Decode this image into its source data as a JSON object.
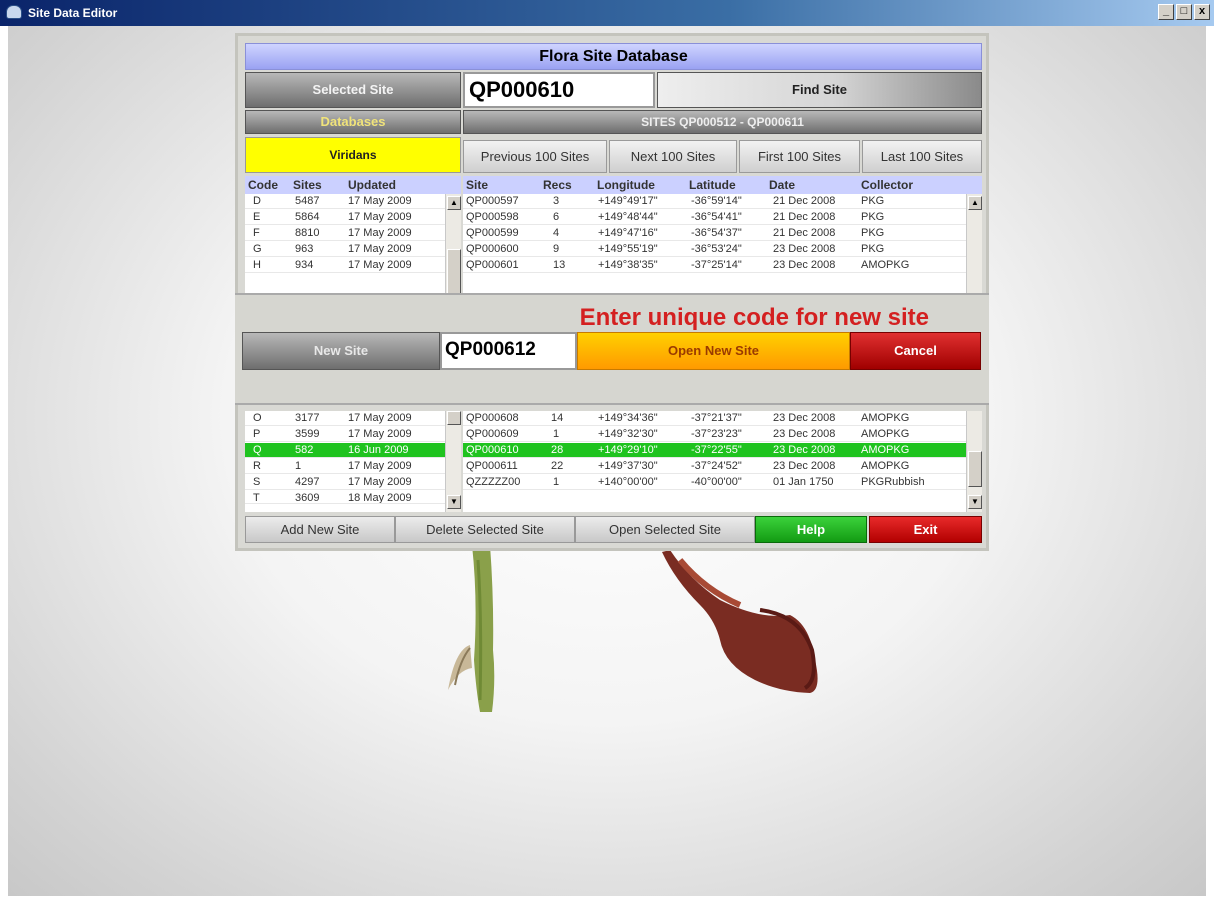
{
  "window": {
    "title": "Site Data Editor",
    "controls": [
      "_",
      "□",
      "x"
    ]
  },
  "dialog": {
    "header": "Flora Site Database",
    "selected_site_label": "Selected Site",
    "selected_site_value": "QP000610",
    "find_site_label": "Find Site",
    "databases_label": "Databases",
    "sites_range": "SITES QP000512 - QP000611",
    "database_name": "Viridans",
    "nav": {
      "previous": "Previous 100 Sites",
      "next": "Next 100 Sites",
      "first": "First 100 Sites",
      "last": "Last 100 Sites"
    },
    "db_table": {
      "headers": [
        "Code",
        "Sites",
        "Updated"
      ],
      "rows_top": [
        [
          "D",
          "5487",
          "17 May 2009"
        ],
        [
          "E",
          "5864",
          "17 May 2009"
        ],
        [
          "F",
          "8810",
          "17 May 2009"
        ],
        [
          "G",
          "963",
          "17 May 2009"
        ],
        [
          "H",
          "934",
          "17 May 2009"
        ]
      ],
      "rows_bottom": [
        [
          "O",
          "3177",
          "17 May 2009"
        ],
        [
          "P",
          "3599",
          "17 May 2009"
        ],
        [
          "Q",
          "582",
          "16 Jun 2009"
        ],
        [
          "R",
          "1",
          "17 May 2009"
        ],
        [
          "S",
          "4297",
          "17 May 2009"
        ],
        [
          "T",
          "3609",
          "18 May 2009"
        ]
      ]
    },
    "site_table": {
      "headers": [
        "Site",
        "Recs",
        "Longitude",
        "Latitude",
        "Date",
        "Collector"
      ],
      "rows_top": [
        [
          "QP000597",
          "3",
          "+149°49'17\"",
          "-36°59'14\"",
          "21 Dec 2008",
          "PKG"
        ],
        [
          "QP000598",
          "6",
          "+149°48'44\"",
          "-36°54'41\"",
          "21 Dec 2008",
          "PKG"
        ],
        [
          "QP000599",
          "4",
          "+149°47'16\"",
          "-36°54'37\"",
          "21 Dec 2008",
          "PKG"
        ],
        [
          "QP000600",
          "9",
          "+149°55'19\"",
          "-36°53'24\"",
          "23 Dec 2008",
          "PKG"
        ],
        [
          "QP000601",
          "13",
          "+149°38'35\"",
          "-37°25'14\"",
          "23 Dec 2008",
          "AMOPKG"
        ]
      ],
      "rows_bottom": [
        [
          "QP000608",
          "14",
          "+149°34'36\"",
          "-37°21'37\"",
          "23 Dec 2008",
          "AMOPKG"
        ],
        [
          "QP000609",
          "1",
          "+149°32'30\"",
          "-37°23'23\"",
          "23 Dec 2008",
          "AMOPKG"
        ],
        [
          "QP000610",
          "28",
          "+149°29'10\"",
          "-37°22'55\"",
          "23 Dec 2008",
          "AMOPKG"
        ],
        [
          "QP000611",
          "22",
          "+149°37'30\"",
          "-37°24'52\"",
          "23 Dec 2008",
          "AMOPKG"
        ],
        [
          "QZZZZZ00",
          "1",
          "+140°00'00\"",
          "-40°00'00\"",
          "01 Jan 1750",
          "PKGRubbish"
        ]
      ]
    },
    "buttons": {
      "add_new_site": "Add New Site",
      "delete_selected_site": "Delete Selected Site",
      "open_selected_site": "Open Selected Site",
      "help": "Help",
      "exit": "Exit"
    }
  },
  "new_site_dialog": {
    "prompt": "Enter unique code for new site",
    "new_site_label": "New Site",
    "new_site_value": "QP000612",
    "open_new_site": "Open New Site",
    "cancel": "Cancel"
  },
  "colors": {
    "header_blue": "#b0b6fa",
    "highlight_yellow": "#ffff00",
    "selected_row_green": "#1fc31f",
    "open_button_orange": "#ffb400",
    "cancel_red": "#c01818",
    "prompt_red": "#d42020"
  }
}
